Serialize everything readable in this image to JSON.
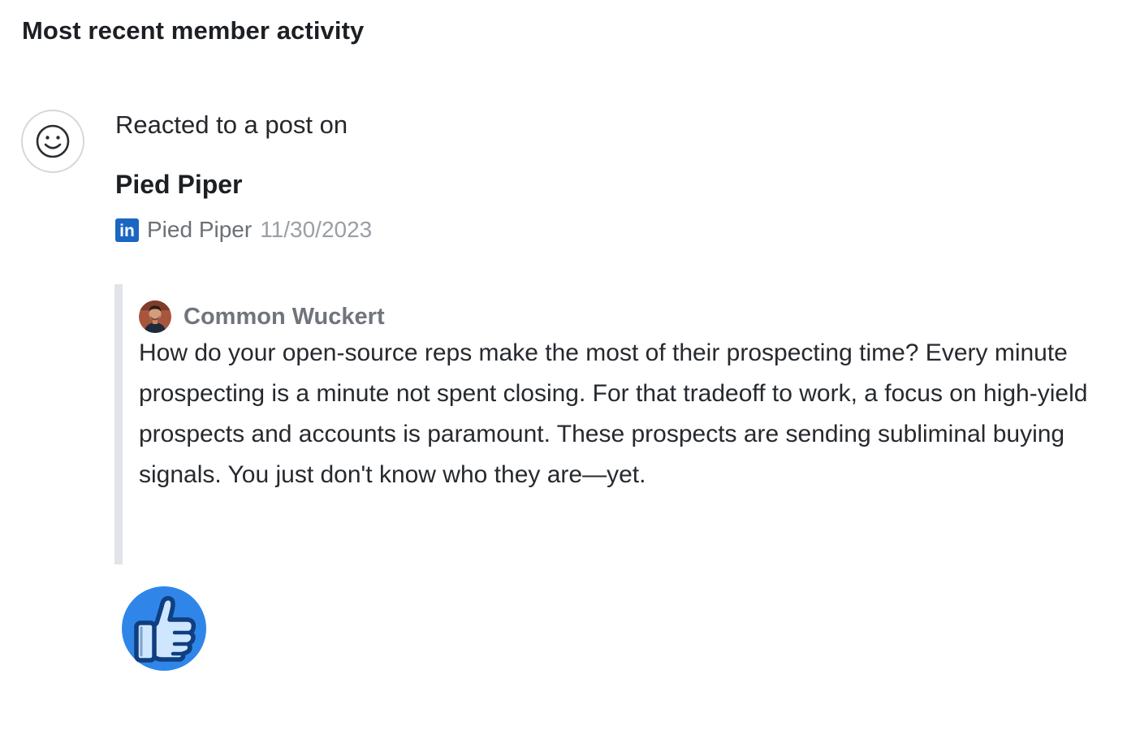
{
  "section": {
    "title": "Most recent member activity"
  },
  "activity": {
    "icon": "smiley-face-icon",
    "description": "Reacted to a post on",
    "company": "Pied Piper",
    "source": {
      "network_icon": "linkedin-icon",
      "network_logo_text": "in",
      "name": "Pied Piper",
      "date": "11/30/2023"
    },
    "post": {
      "author_avatar_icon": "user-avatar-photo",
      "author": "Common Wuckert",
      "text": "How do your open-source reps make the most of their prospecting time? Every minute prospecting is a minute not spent closing. For that tradeoff to work, a focus on high-yield prospects and accounts is paramount. These prospects are sending subliminal buying signals. You just don't know who they are—yet."
    },
    "reaction": {
      "icon": "thumbs-up-like-icon"
    }
  },
  "colors": {
    "linkedin_blue": "#1a66c2",
    "reaction_blue": "#2f86e8",
    "reaction_dark": "#0f3f80",
    "reaction_light": "#cfe6ff",
    "quote_bar": "#e2e3e8",
    "muted_text": "#70747c"
  }
}
